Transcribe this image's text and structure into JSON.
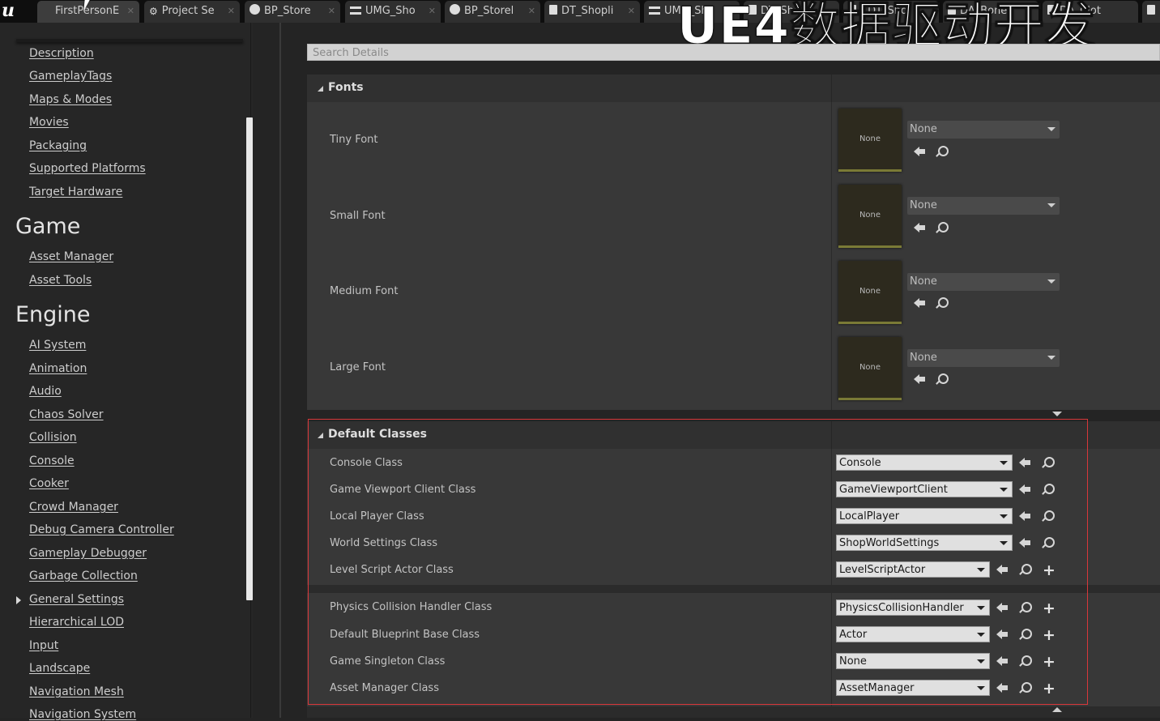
{
  "tabs": [
    {
      "label": "FirstPersonE",
      "icon": "none"
    },
    {
      "label": "Project Se",
      "icon": "gear-icon"
    },
    {
      "label": "BP_Store",
      "icon": "circle-icon"
    },
    {
      "label": "UMG_Sho",
      "icon": "widget-icon"
    },
    {
      "label": "BP_Storel",
      "icon": "circle-icon"
    },
    {
      "label": "DT_Shopli",
      "icon": "datatable-icon"
    },
    {
      "label": "UMG_Sho",
      "icon": "widget-icon"
    },
    {
      "label": "DT_Shop",
      "icon": "datatable-icon"
    },
    {
      "label": "CDT_Sho",
      "icon": "datatable-icon"
    },
    {
      "label": "DA_Bone",
      "icon": "datatable-icon"
    },
    {
      "label": "DA_Clot",
      "icon": "datatable-icon"
    }
  ],
  "overlay_title": "UE4数据驱动开发",
  "sidebar": {
    "items_top": [
      "Description",
      "GameplayTags",
      "Maps & Modes",
      "Movies",
      "Packaging",
      "Supported Platforms",
      "Target Hardware"
    ],
    "game_heading": "Game",
    "game_items": [
      "Asset Manager",
      "Asset Tools"
    ],
    "engine_heading": "Engine",
    "engine_items": [
      "AI System",
      "Animation",
      "Audio",
      "Chaos Solver",
      "Collision",
      "Console",
      "Cooker",
      "Crowd Manager",
      "Debug Camera Controller",
      "Gameplay Debugger",
      "Garbage Collection",
      "General Settings",
      "Hierarchical LOD",
      "Input",
      "Landscape",
      "Navigation Mesh",
      "Navigation System"
    ]
  },
  "search": {
    "placeholder": "Search Details"
  },
  "fonts": {
    "heading": "Fonts",
    "rows": [
      {
        "label": "Tiny Font",
        "thumb": "None",
        "value": "None"
      },
      {
        "label": "Small Font",
        "thumb": "None",
        "value": "None"
      },
      {
        "label": "Medium Font",
        "thumb": "None",
        "value": "None"
      },
      {
        "label": "Large Font",
        "thumb": "None",
        "value": "None"
      }
    ]
  },
  "default_classes": {
    "heading": "Default Classes",
    "rows": [
      {
        "label": "Console Class",
        "value": "Console",
        "has_plus": false
      },
      {
        "label": "Game Viewport Client Class",
        "value": "GameViewportClient",
        "has_plus": false
      },
      {
        "label": "Local Player Class",
        "value": "LocalPlayer",
        "has_plus": false
      },
      {
        "label": "World Settings Class",
        "value": "ShopWorldSettings",
        "has_plus": false
      },
      {
        "label": "Level Script Actor Class",
        "value": "LevelScriptActor",
        "has_plus": true
      },
      {
        "label": "Physics Collision Handler Class",
        "value": "PhysicsCollisionHandler",
        "has_plus": true
      },
      {
        "label": "Default Blueprint Base Class",
        "value": "Actor",
        "has_plus": true
      },
      {
        "label": "Game Singleton Class",
        "value": "None",
        "has_plus": true
      },
      {
        "label": "Asset Manager Class",
        "value": "AssetManager",
        "has_plus": true
      }
    ]
  },
  "colors": {
    "highlight_box": "#d8373a",
    "thumb_border": "#7a7a36"
  }
}
